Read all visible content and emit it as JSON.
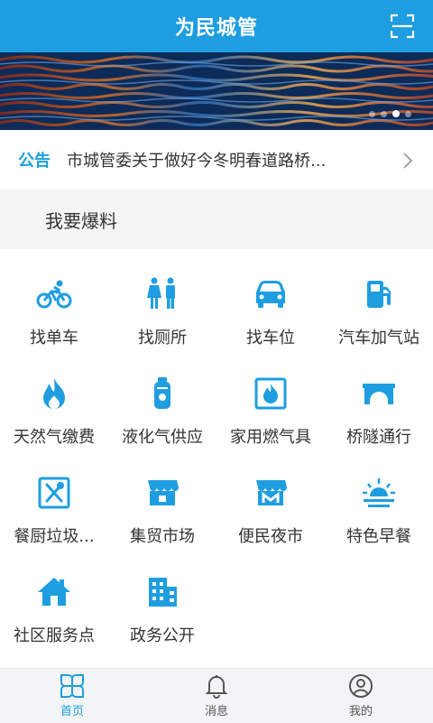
{
  "header": {
    "title": "为民城管",
    "scan_icon": "scan-icon"
  },
  "banner": {
    "dots": 4,
    "active_dot": 2
  },
  "notice": {
    "tag": "公告",
    "text": "市城管委关于做好今冬明春道路桥..."
  },
  "section": {
    "label": "我要爆料"
  },
  "services": [
    {
      "label": "找单车",
      "icon": "bicycle-icon"
    },
    {
      "label": "找厕所",
      "icon": "restroom-icon"
    },
    {
      "label": "找车位",
      "icon": "car-icon"
    },
    {
      "label": "汽车加气站",
      "icon": "gas-station-icon"
    },
    {
      "label": "天然气缴费",
      "icon": "flame-icon"
    },
    {
      "label": "液化气供应",
      "icon": "gas-cylinder-icon"
    },
    {
      "label": "家用燃气具",
      "icon": "fire-box-icon"
    },
    {
      "label": "桥隧通行",
      "icon": "bridge-icon"
    },
    {
      "label": "餐厨垃圾...",
      "icon": "dining-icon"
    },
    {
      "label": "集贸市场",
      "icon": "market-icon"
    },
    {
      "label": "便民夜市",
      "icon": "night-market-icon"
    },
    {
      "label": "特色早餐",
      "icon": "sunrise-icon"
    },
    {
      "label": "社区服务点",
      "icon": "home-icon"
    },
    {
      "label": "政务公开",
      "icon": "building-icon"
    }
  ],
  "tabbar": {
    "items": [
      {
        "label": "首页",
        "icon": "home-grid-icon",
        "active": true
      },
      {
        "label": "消息",
        "icon": "bell-icon",
        "active": false
      },
      {
        "label": "我的",
        "icon": "user-icon",
        "active": false
      }
    ]
  },
  "colors": {
    "accent": "#1e9ee0",
    "text": "#333333",
    "section_bg": "#f5f5f5",
    "tabbar_bg": "#f2f4f6"
  }
}
